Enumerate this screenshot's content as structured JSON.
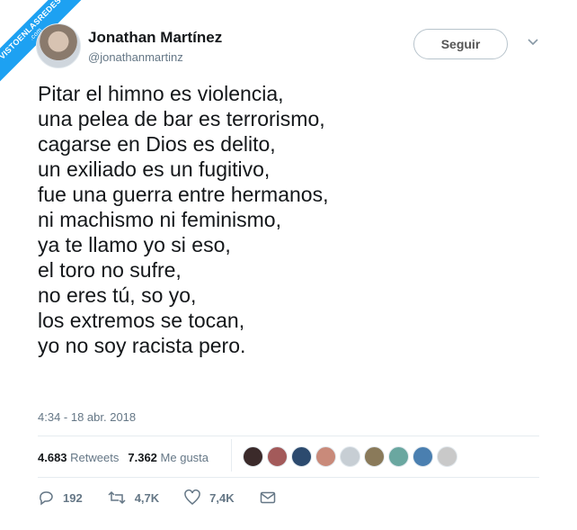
{
  "watermark": {
    "main": "VISTOENLASREDES",
    "sub": ".com"
  },
  "user": {
    "name": "Jonathan Martínez",
    "handle": "@jonathanmartinz"
  },
  "follow_label": "Seguir",
  "tweet": {
    "text": "Pitar el himno es violencia,\nuna pelea de bar es terrorismo,\ncagarse en Dios es delito,\nun exiliado es un fugitivo,\nfue una guerra entre hermanos,\nni machismo ni feminismo,\nya te llamo yo si eso,\nel toro no sufre,\nno eres tú, so yo,\nlos extremos se tocan,\nyo no soy racista pero.",
    "timestamp": "4:34 - 18 abr. 2018"
  },
  "stats": {
    "retweets_count": "4.683",
    "retweets_label": "Retweets",
    "likes_count": "7.362",
    "likes_label": "Me gusta"
  },
  "likers": [
    "#3b2a2a",
    "#a35a5a",
    "#2c4a6e",
    "#c98a7a",
    "#c7ced4",
    "#8a7a5a",
    "#6aa7a0",
    "#4a7fb0",
    "#c9c9c9"
  ],
  "actions": {
    "replies": "192",
    "retweets": "4,7K",
    "likes": "7,4K"
  },
  "colors": {
    "accent": "#1da1f2",
    "muted": "#657786"
  }
}
